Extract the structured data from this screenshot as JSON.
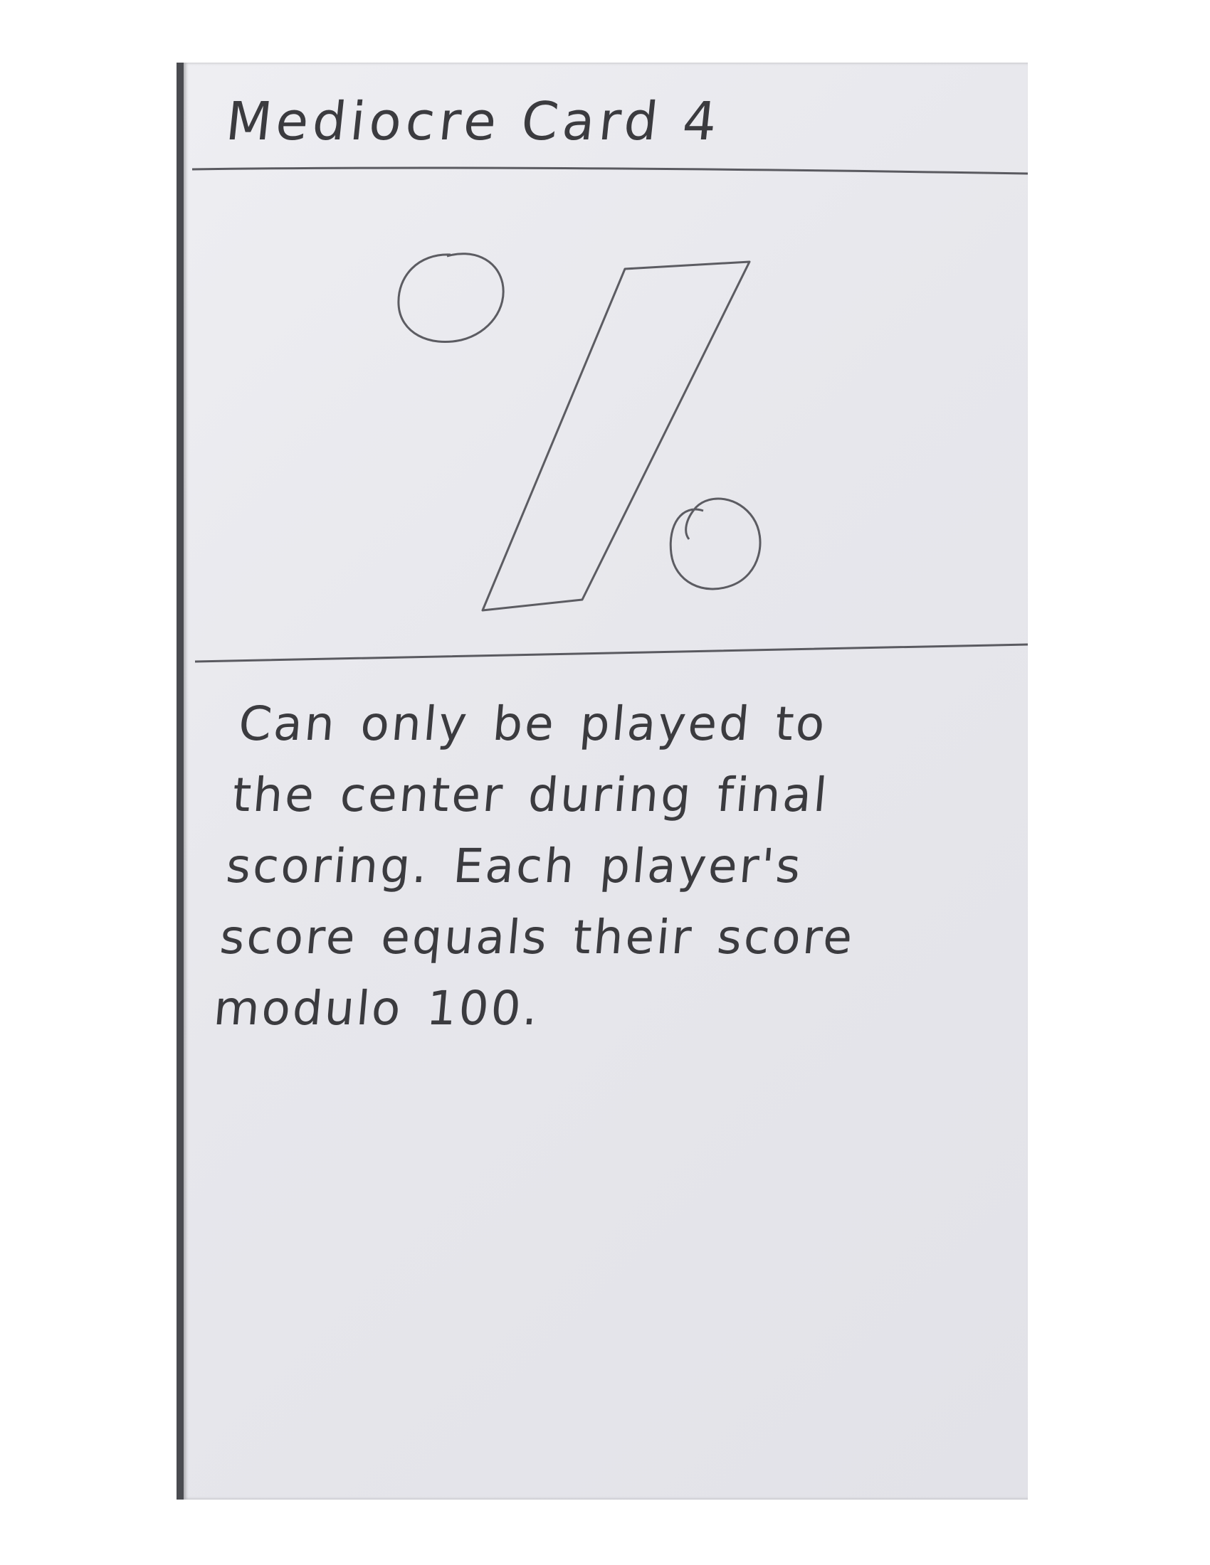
{
  "card": {
    "title": "Mediocre Card 4",
    "symbol": "%",
    "rules_lines": [
      "Can only be played to",
      "the center during final",
      "scoring. Each player's",
      "score equals their score",
      "modulo 100."
    ]
  },
  "colors": {
    "paper": "#e8e8ed",
    "pencil": "#3b3b3f",
    "backing": "#4a4b50"
  }
}
